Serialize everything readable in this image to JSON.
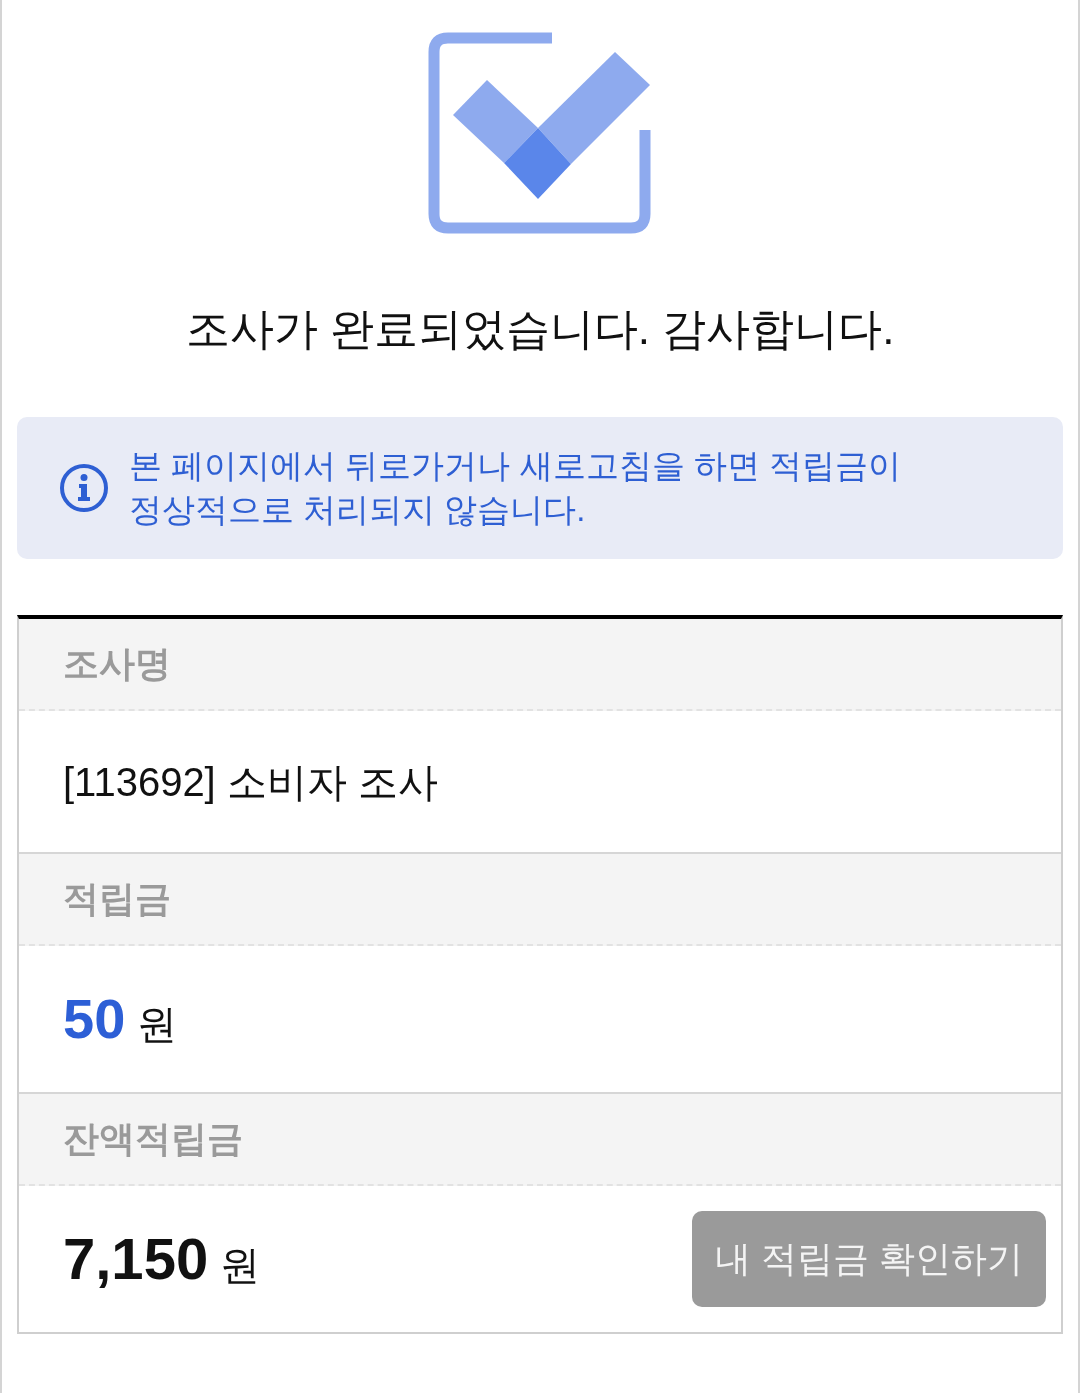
{
  "title": "조사가 완료되었습니다. 감사합니다.",
  "notice": {
    "lines": [
      "본 페이지에서 뒤로가거나 새로고침을 하면 적립금이",
      "정상적으로 처리되지 않습니다."
    ]
  },
  "details": [
    {
      "kind": "text",
      "label": "조사명",
      "value": "[113692] 소비자 조사"
    },
    {
      "kind": "reward",
      "label": "적립금",
      "amount": "50",
      "unit": "원"
    },
    {
      "kind": "balance",
      "label": "잔액적립금",
      "amount": "7,150",
      "unit": "원",
      "button": "내 적립금 확인하기"
    }
  ]
}
